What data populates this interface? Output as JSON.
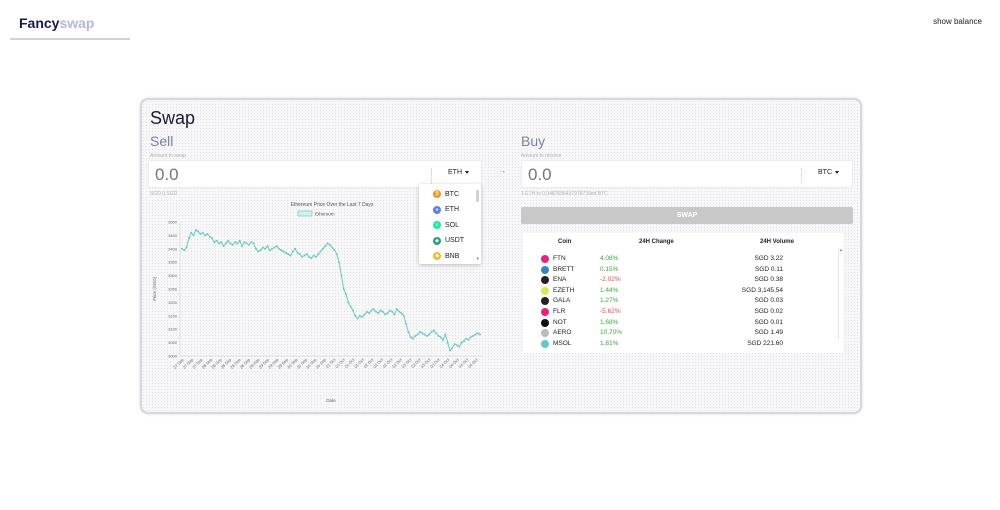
{
  "header": {
    "logo_main": "Fancy",
    "logo_accent": "swap",
    "show_balance": "show balance"
  },
  "swap": {
    "title": "Swap",
    "arrow": "→",
    "sell": {
      "label": "Sell",
      "caption": "Amount to swap",
      "amount": "0.0",
      "token": "ETH",
      "fiat": "SGD 0.SGD"
    },
    "buy": {
      "label": "Buy",
      "caption": "Amount to receive",
      "amount": "0.0",
      "token": "BTC",
      "rate": "1 ETH to 0.0487696437976739ed BTC"
    },
    "swap_button": "SWAP"
  },
  "token_dropdown": {
    "items": [
      {
        "symbol": "BTC",
        "color": "#f7931a",
        "glyph": "₿"
      },
      {
        "symbol": "ETH",
        "color": "#627eea",
        "glyph": "♦"
      },
      {
        "symbol": "SOL",
        "color": "#14f195",
        "glyph": "≡"
      },
      {
        "symbol": "USDT",
        "color": "#26a17b",
        "glyph": "◆"
      },
      {
        "symbol": "BNB",
        "color": "#f3ba2f",
        "glyph": "◆"
      }
    ]
  },
  "chart_data": {
    "type": "line",
    "title": "Ethereum Price Over the Last 7 Days",
    "xlabel": "Date",
    "ylabel": "Price (SGD)",
    "series": [
      {
        "name": "Ethereum",
        "color": "#70c8c0"
      }
    ],
    "ylim": [
      3000,
      3500
    ],
    "yticks": [
      3000,
      3050,
      3100,
      3150,
      3200,
      3250,
      3300,
      3350,
      3400,
      3450,
      3500
    ],
    "xticks": [
      "27 Sep",
      "27 Sep",
      "27 Sep",
      "28 Sep",
      "28 Sep",
      "28 Sep",
      "28 Sep",
      "28 Sep",
      "29 Sep",
      "29 Sep",
      "29 Sep",
      "29 Sep",
      "30 Sep",
      "30 Sep",
      "30 Sep",
      "30 Sep",
      "01 Oct",
      "01 Oct",
      "01 Oct",
      "01 Oct",
      "02 Oct",
      "02 Oct",
      "02 Oct",
      "02 Oct",
      "03 Oct",
      "03 Oct",
      "03 Oct",
      "03 Oct",
      "04 Oct",
      "04 Oct",
      "04 Oct",
      "04 Oct"
    ],
    "values": [
      3400,
      3395,
      3405,
      3440,
      3460,
      3450,
      3470,
      3465,
      3455,
      3460,
      3450,
      3455,
      3445,
      3440,
      3425,
      3430,
      3420,
      3425,
      3410,
      3420,
      3430,
      3420,
      3415,
      3425,
      3420,
      3430,
      3410,
      3425,
      3420,
      3415,
      3425,
      3420,
      3400,
      3390,
      3395,
      3405,
      3400,
      3410,
      3395,
      3400,
      3405,
      3410,
      3400,
      3395,
      3390,
      3385,
      3380,
      3375,
      3390,
      3400,
      3385,
      3380,
      3370,
      3375,
      3380,
      3370,
      3365,
      3375,
      3370,
      3380,
      3390,
      3400,
      3410,
      3420,
      3415,
      3405,
      3395,
      3380,
      3350,
      3300,
      3250,
      3230,
      3200,
      3185,
      3170,
      3150,
      3140,
      3150,
      3145,
      3155,
      3165,
      3160,
      3170,
      3175,
      3165,
      3160,
      3170,
      3165,
      3155,
      3160,
      3170,
      3165,
      3155,
      3175,
      3165,
      3160,
      3150,
      3120,
      3090,
      3070,
      3065,
      3075,
      3080,
      3090,
      3085,
      3080,
      3075,
      3080,
      3090,
      3095,
      3085,
      3075,
      3070,
      3060,
      3080,
      3050,
      3020,
      3030,
      3045,
      3040,
      3035,
      3050,
      3055,
      3065,
      3060,
      3070,
      3075,
      3080,
      3085,
      3080
    ]
  },
  "market_table": {
    "headers": {
      "coin": "Coin",
      "change": "24H Change",
      "volume": "24H Volume"
    },
    "rows": [
      {
        "symbol": "FTN",
        "change": "4.08%",
        "dir": "up",
        "volume": "SGD 3.22",
        "color": "#e8217d"
      },
      {
        "symbol": "BRETT",
        "change": "0.15%",
        "dir": "up",
        "volume": "SGD 0.11",
        "color": "#3b82c4"
      },
      {
        "symbol": "ENA",
        "change": "-2.02%",
        "dir": "down",
        "volume": "SGD 0.38",
        "color": "#222222"
      },
      {
        "symbol": "EZETH",
        "change": "1.44%",
        "dir": "up",
        "volume": "SGD 3,145.54",
        "color": "#d9e85a"
      },
      {
        "symbol": "GALA",
        "change": "1.27%",
        "dir": "up",
        "volume": "SGD 0.03",
        "color": "#222222"
      },
      {
        "symbol": "FLR",
        "change": "-5.62%",
        "dir": "down",
        "volume": "SGD 0.02",
        "color": "#e6247a"
      },
      {
        "symbol": "NOT",
        "change": "1.68%",
        "dir": "up",
        "volume": "SGD 0.01",
        "color": "#111111"
      },
      {
        "symbol": "AERO",
        "change": "10.70%",
        "dir": "up",
        "volume": "SGD 1.49",
        "color": "#bbbbbb"
      },
      {
        "symbol": "MSOL",
        "change": "1.81%",
        "dir": "up",
        "volume": "SGD 221.60",
        "color": "#62c8c8"
      }
    ]
  }
}
